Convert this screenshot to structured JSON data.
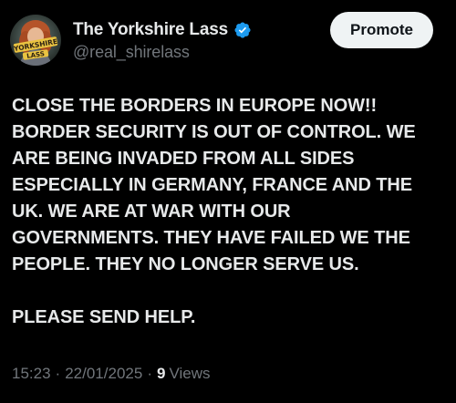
{
  "author": {
    "display_name": "The Yorkshire Lass",
    "handle": "@real_shirelass",
    "verified_icon": "verified-badge-icon",
    "avatar_text": "YORKSHIRE LASS"
  },
  "promote_label": "Promote",
  "post": {
    "paragraphs": [
      "CLOSE THE BORDERS IN EUROPE NOW!!\nBORDER SECURITY IS OUT OF CONTROL. WE\nARE BEING INVADED FROM ALL SIDES\nESPECIALLY IN GERMANY, FRANCE AND THE\nUK. WE ARE AT WAR WITH OUR\nGOVERNMENTS. THEY HAVE FAILED WE THE\nPEOPLE. THEY NO LONGER SERVE US.",
      "PLEASE SEND HELP."
    ]
  },
  "meta": {
    "time": "15:23",
    "separator": "·",
    "date": "22/01/2025",
    "views_count": "9",
    "views_label": "Views"
  },
  "colors": {
    "background": "#000000",
    "text": "#e7e9ea",
    "muted": "#71767b",
    "verified": "#1d9bf0",
    "button_bg": "#eff3f4"
  }
}
